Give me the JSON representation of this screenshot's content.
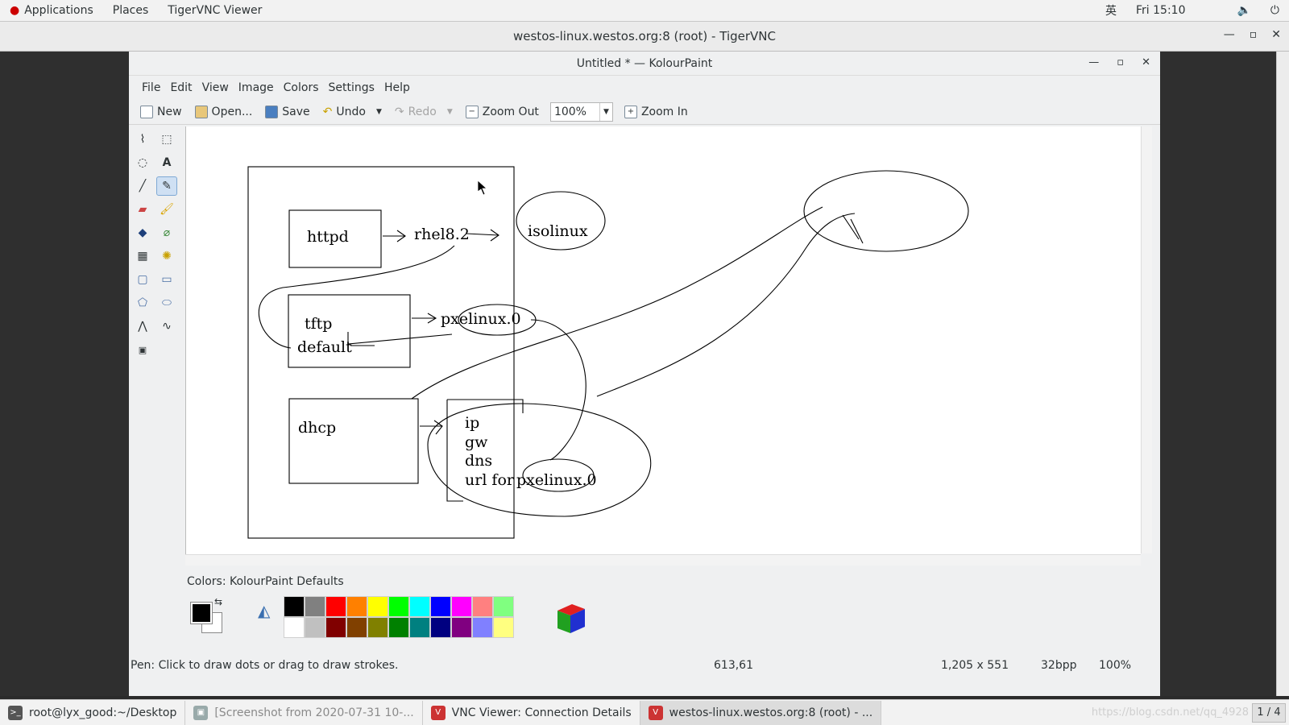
{
  "top_panel": {
    "applications": "Applications",
    "places": "Places",
    "app_name": "TigerVNC Viewer",
    "input_method": "英",
    "clock": "Fri 15:10"
  },
  "vnc_window": {
    "title": "westos-linux.westos.org:8 (root) - TigerVNC"
  },
  "kolourpaint": {
    "title": "Untitled * — KolourPaint",
    "menu": [
      "File",
      "Edit",
      "View",
      "Image",
      "Colors",
      "Settings",
      "Help"
    ],
    "toolbar": {
      "new": "New",
      "open": "Open...",
      "save": "Save",
      "undo": "Undo",
      "redo": "Redo",
      "zoom_out": "Zoom Out",
      "zoom_value": "100%",
      "zoom_in": "Zoom In"
    },
    "canvas_text": {
      "httpd": "httpd",
      "rhel": "rhel8.2",
      "isolinux": "isolinux",
      "tftp": "tftp",
      "default": "default",
      "pxelinux": "pxelinux.0",
      "dhcp": "dhcp",
      "ip": "ip",
      "gw": "gw",
      "dns": "dns",
      "url_for": "url  for",
      "pxelinux2": "pxelinux.0"
    },
    "colors_label": "Colors: KolourPaint Defaults",
    "palette": {
      "row1": [
        "#000000",
        "#808080",
        "#ff0000",
        "#ff8000",
        "#ffff00",
        "#00ff00",
        "#00ffff",
        "#0000ff",
        "#ff00ff",
        "#ff8080",
        "#80ff80"
      ],
      "row2": [
        "#ffffff",
        "#c0c0c0",
        "#800000",
        "#804000",
        "#808000",
        "#008000",
        "#008080",
        "#000080",
        "#800080",
        "#8080ff",
        "#ffff80"
      ]
    },
    "status": {
      "hint": "Pen: Click to draw dots or drag to draw strokes.",
      "coords": "613,61",
      "size": "1,205 x 551",
      "depth": "32bpp",
      "zoom": "100%"
    }
  },
  "taskbar": {
    "tasks": [
      "root@lyx_good:~/Desktop",
      "[Screenshot from 2020-07-31 10-...",
      "VNC Viewer: Connection Details",
      "westos-linux.westos.org:8 (root) - ..."
    ],
    "watermark": "https://blog.csdn.net/qq_4928",
    "pager": "1 / 4"
  }
}
